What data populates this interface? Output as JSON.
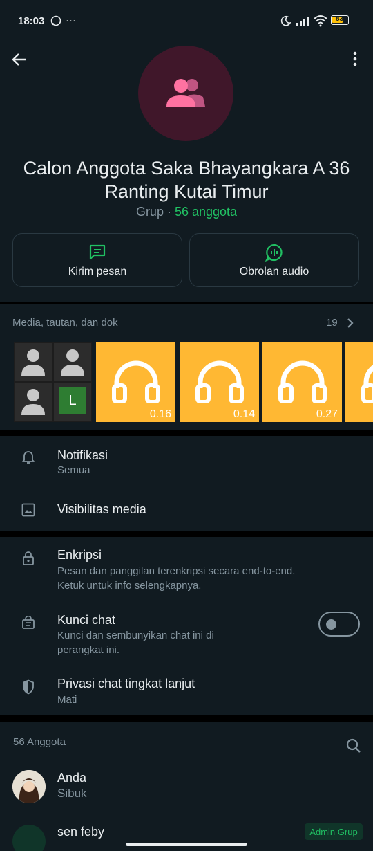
{
  "status": {
    "time": "18:03",
    "battery": "83"
  },
  "header": {
    "group_name_line1": "Calon Anggota Saka Bhayangkara A 36",
    "group_name_line2": "Ranting Kutai Timur",
    "group_type": "Grup",
    "separator": " · ",
    "members_count": "56 anggota"
  },
  "actions": {
    "message_label": "Kirim pesan",
    "audio_label": "Obrolan audio"
  },
  "media": {
    "title": "Media, tautan, dan dok",
    "count": "19",
    "thumbs": [
      {
        "type": "video-call",
        "tile_letter": "L",
        "duration": ""
      },
      {
        "type": "audio",
        "duration": "0.16"
      },
      {
        "type": "audio",
        "duration": "0.14"
      },
      {
        "type": "audio",
        "duration": "0.27"
      },
      {
        "type": "audio",
        "duration": ""
      }
    ]
  },
  "settings": {
    "notifications": {
      "title": "Notifikasi",
      "value": "Semua"
    },
    "media_visibility": {
      "title": "Visibilitas media"
    }
  },
  "privacy": {
    "encryption": {
      "title": "Enkripsi",
      "line1": "Pesan dan panggilan terenkripsi secara end-to-end.",
      "line2": "Ketuk untuk info selengkapnya."
    },
    "chat_lock": {
      "title": "Kunci chat",
      "line1": "Kunci dan sembunyikan chat ini di",
      "line2": "perangkat ini.",
      "enabled": false
    },
    "advanced": {
      "title": "Privasi chat tingkat lanjut",
      "value": "Mati"
    }
  },
  "members": {
    "header": "56 Anggota",
    "list": [
      {
        "name": "Anda",
        "status": "Sibuk",
        "badge": ""
      },
      {
        "name": "sen feby",
        "status": "",
        "badge": "Admin Grup"
      }
    ]
  },
  "colors": {
    "accent": "#21c063",
    "background": "#111b21",
    "avatar_bg": "#40172a",
    "avatar_icon": "#ff72a1",
    "audio_thumb": "#ffb833"
  }
}
